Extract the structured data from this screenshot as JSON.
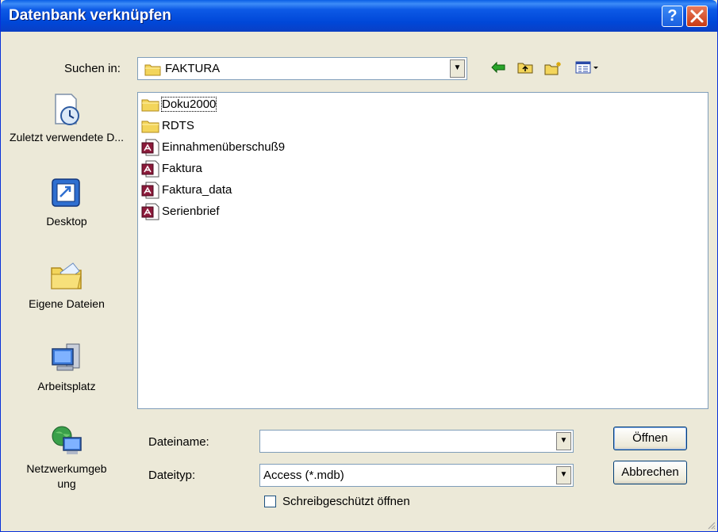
{
  "window": {
    "title": "Datenbank verknüpfen",
    "help_label": "?",
    "close_label": "✕"
  },
  "lookin": {
    "label": "Suchen in:",
    "value": "FAKTURA"
  },
  "toolbar": {
    "back_icon": "back-arrow-icon",
    "up_icon": "up-folder-icon",
    "new_folder_icon": "new-folder-icon",
    "views_icon": "views-menu-icon"
  },
  "places": [
    {
      "label": "Zuletzt verwendete D...",
      "icon": "recent-documents-icon"
    },
    {
      "label": "Desktop",
      "icon": "desktop-icon"
    },
    {
      "label": "Eigene Dateien",
      "icon": "my-documents-icon"
    },
    {
      "label": "Arbeitsplatz",
      "icon": "my-computer-icon"
    },
    {
      "label": "Netzwerkumgeb ung",
      "icon": "network-places-icon"
    }
  ],
  "files": [
    {
      "name": "Doku2000",
      "type": "folder",
      "selected": true
    },
    {
      "name": "RDTS",
      "type": "folder"
    },
    {
      "name": "Einnahmenüberschuß9",
      "type": "access-db"
    },
    {
      "name": "Faktura",
      "type": "access-db"
    },
    {
      "name": "Faktura_data",
      "type": "access-db"
    },
    {
      "name": "Serienbrief",
      "type": "access-db"
    }
  ],
  "filename": {
    "label": "Dateiname:",
    "value": ""
  },
  "filetype": {
    "label": "Dateityp:",
    "value": "Access (*.mdb)"
  },
  "readonly": {
    "label": "Schreibgeschützt öffnen",
    "checked": false
  },
  "buttons": {
    "open": "Öffnen",
    "cancel": "Abbrechen"
  },
  "colors": {
    "title_bar": "#0054e3",
    "dialog_bg": "#ece9d8",
    "folder": "#f3d55b",
    "access": "#8b1a3a"
  }
}
